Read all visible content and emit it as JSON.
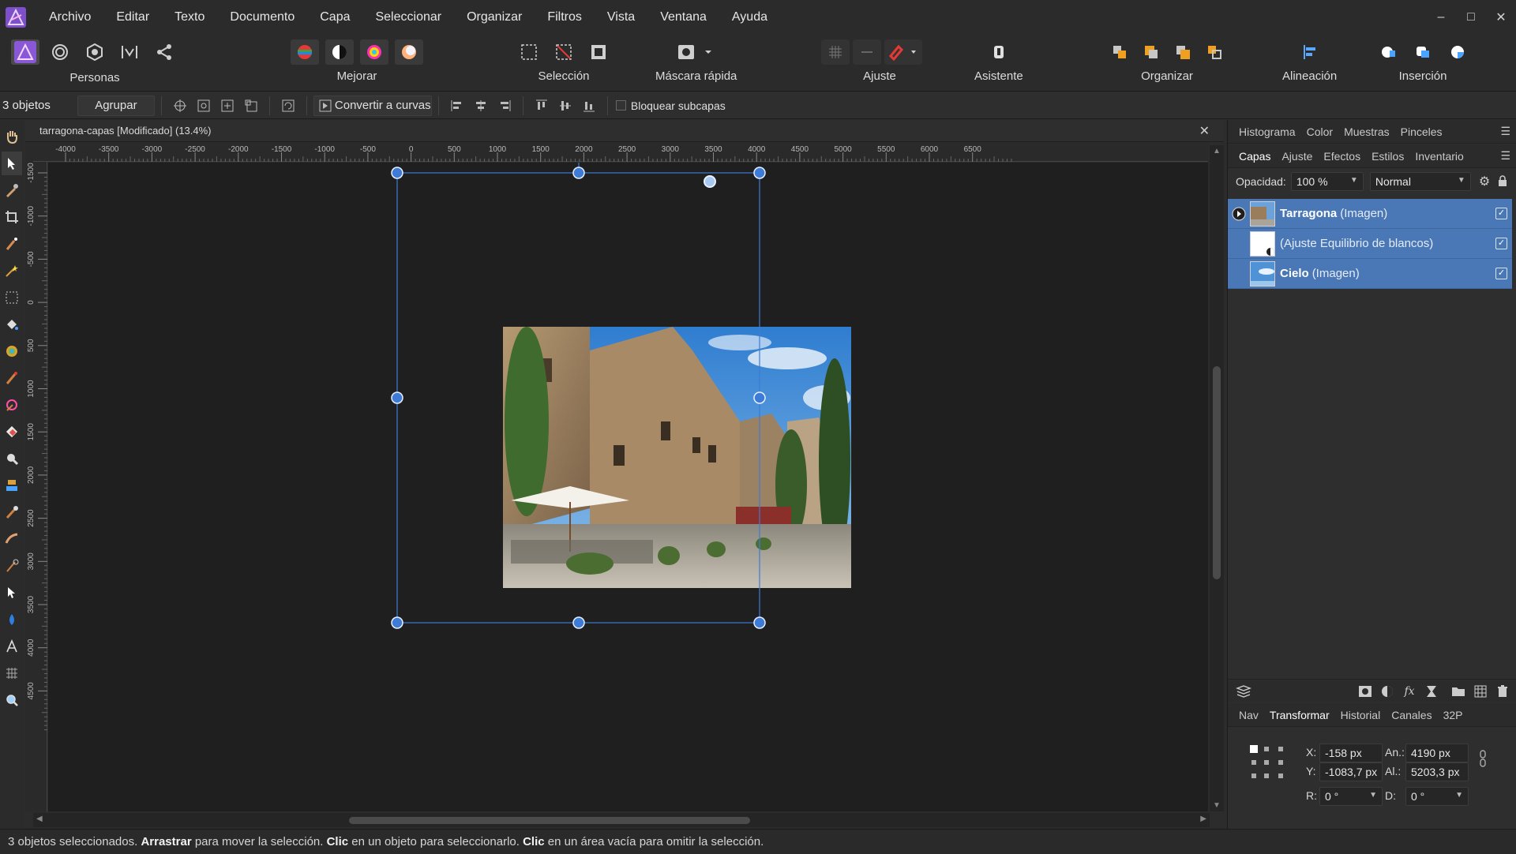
{
  "menu": [
    "Archivo",
    "Editar",
    "Texto",
    "Documento",
    "Capa",
    "Seleccionar",
    "Organizar",
    "Filtros",
    "Vista",
    "Ventana",
    "Ayuda"
  ],
  "toolbar": {
    "personas": "Personas",
    "mejorar": "Mejorar",
    "seleccion": "Selección",
    "mascara": "Máscara rápida",
    "ajuste": "Ajuste",
    "asistente": "Asistente",
    "organizar": "Organizar",
    "alineacion": "Alineación",
    "insercion": "Inserción"
  },
  "context": {
    "selection_count": "3 objetos",
    "group_label": "Agrupar",
    "convert_label": "Convertir a curvas",
    "lock_children": "Bloquear subcapas"
  },
  "document": {
    "title": "tarragona-capas [Modificado] (13.4%)",
    "unit": "px",
    "h_ticks": [
      "-4000",
      "-3500",
      "-3000",
      "-2500",
      "-2000",
      "-1500",
      "-1000",
      "-500",
      "0",
      "500",
      "1000",
      "1500",
      "2000",
      "2500",
      "3000",
      "3500",
      "4000",
      "4500",
      "5000",
      "5500",
      "6000",
      "6500"
    ],
    "v_ticks": [
      "-1500",
      "-1000",
      "-500",
      "0",
      "500",
      "1000",
      "1500",
      "2000",
      "2500",
      "3000",
      "3500",
      "4000",
      "4500"
    ]
  },
  "panel_top_tabs": [
    "Histograma",
    "Color",
    "Muestras",
    "Pinceles"
  ],
  "panel_layer_tabs": [
    "Capas",
    "Ajuste",
    "Efectos",
    "Estilos",
    "Inventario"
  ],
  "layers_panel": {
    "opacity_label": "Opacidad:",
    "opacity_value": "100 %",
    "blend_mode": "Normal",
    "layers": [
      {
        "name": "Tarragona",
        "kind": "(Imagen)"
      },
      {
        "name": "",
        "kind": "(Ajuste Equilibrio de blancos)"
      },
      {
        "name": "Cielo",
        "kind": "(Imagen)"
      }
    ]
  },
  "panel_bottom_tabs": [
    "Nav",
    "Transformar",
    "Historial",
    "Canales",
    "32P"
  ],
  "transform": {
    "x_label": "X:",
    "x_value": "-158 px",
    "y_label": "Y:",
    "y_value": "-1083,7 px",
    "w_label": "An.:",
    "w_value": "4190 px",
    "h_label": "Al.:",
    "h_value": "5203,3 px",
    "r_label": "R:",
    "r_value": "0 °",
    "d_label": "D:",
    "d_value": "0 °"
  },
  "status": {
    "part1": "3 objetos seleccionados. ",
    "bold1": "Arrastrar",
    "part2": " para mover la selección. ",
    "bold2": "Clic",
    "part3": " en un objeto para seleccionarlo. ",
    "bold3": "Clic",
    "part4": " en un área vacía para omitir la selección."
  },
  "colors": {
    "accent": "#4a78b7",
    "selection": "#3d7bd6",
    "sky": "#4f93d6"
  }
}
